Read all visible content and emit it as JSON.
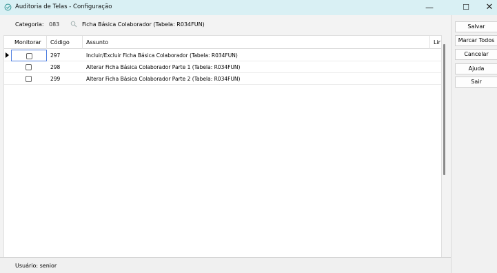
{
  "window": {
    "title": "Auditoria de Telas - Configuração",
    "minimize": "—",
    "maximize": "☐",
    "close": "✕"
  },
  "filter": {
    "label": "Categoria:",
    "value": "083",
    "description": "Ficha Básica Colaborador (Tabela: R034FUN)",
    "search_icon": "search-icon"
  },
  "grid": {
    "columns": [
      "Monitorar",
      "Código",
      "Assunto",
      "Lir"
    ],
    "rows": [
      {
        "monitorar": false,
        "codigo": "297",
        "assunto": "Incluir/Excluir Ficha Básica Colaborador (Tabela: R034FUN)"
      },
      {
        "monitorar": false,
        "codigo": "298",
        "assunto": "Alterar Ficha Básica Colaborador Parte 1 (Tabela: R034FUN)"
      },
      {
        "monitorar": false,
        "codigo": "299",
        "assunto": "Alterar Ficha Básica Colaborador Parte 2 (Tabela: R034FUN)"
      }
    ]
  },
  "status": {
    "user_text": "Usuário: senior"
  },
  "buttons": {
    "salvar": "Salvar",
    "marcar_todos": "Marcar Todos",
    "cancelar": "Cancelar",
    "ajuda": "Ajuda",
    "sair": "Sair"
  },
  "colors": {
    "titlebar": "#d9f0f4",
    "selection_border": "#4f7fe0"
  }
}
